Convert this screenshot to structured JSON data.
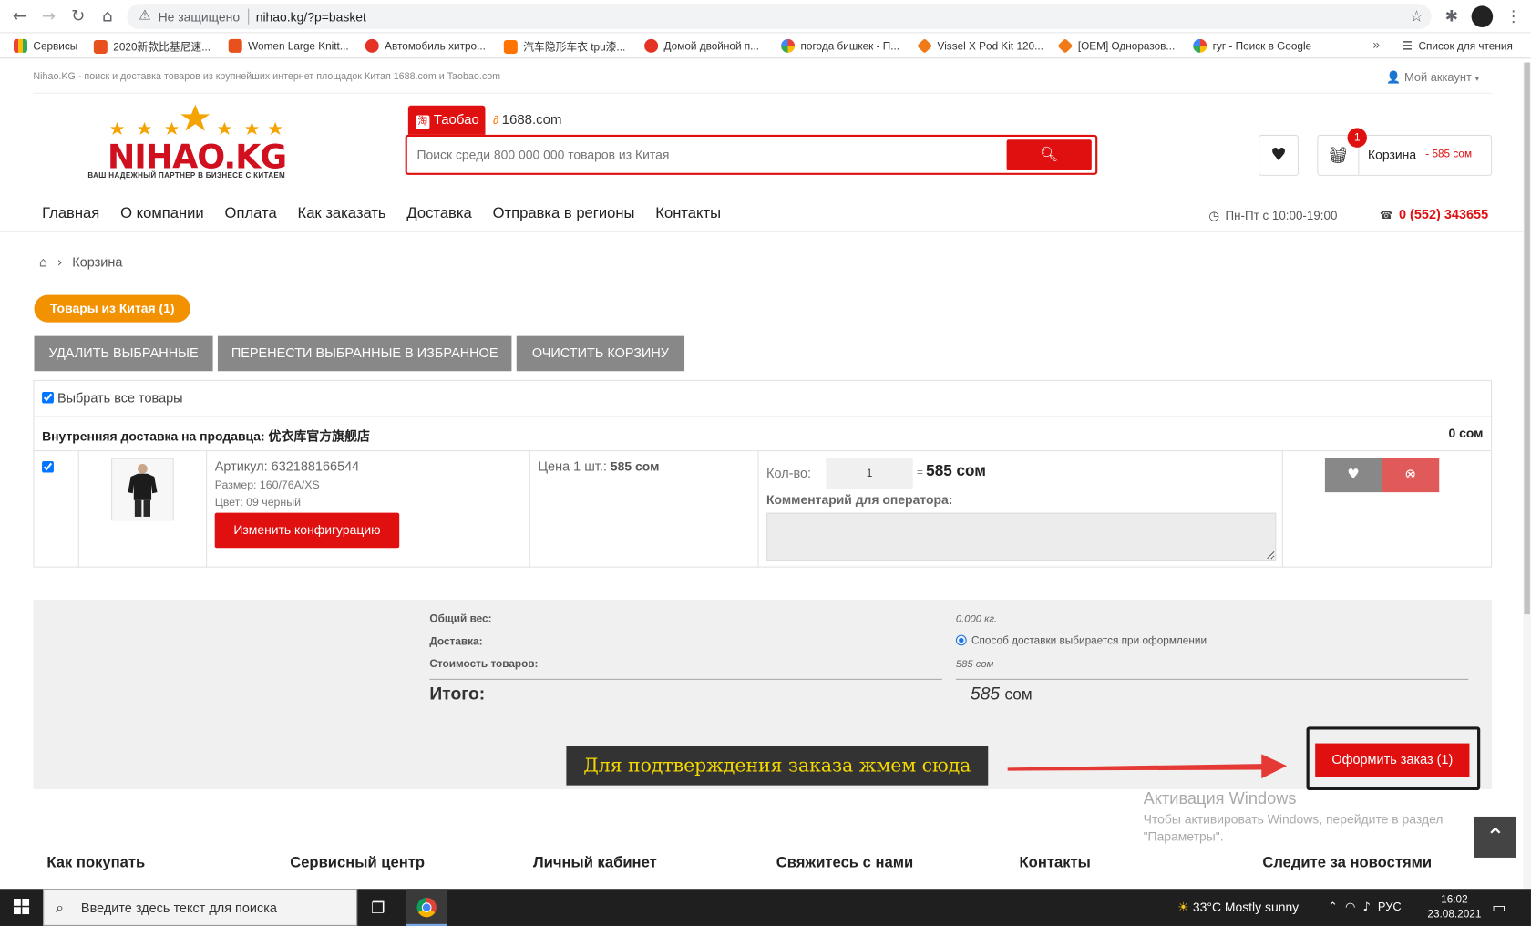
{
  "browser": {
    "insecure_label": "Не защищено",
    "url": "nihao.kg/?p=basket",
    "bookmarks": [
      "Сервисы",
      "2020新款比基尼速...",
      "Women Large Knitt...",
      "Автомобиль хитро...",
      "汽车隐形车衣 tpu漆...",
      "Домой двойной п...",
      "погода бишкек - П...",
      "Vissel X Pod Kit 120...",
      "[OEM] Одноразов...",
      "гуг - Поиск в Google"
    ],
    "reading_list": "Список для чтения",
    "more": "»"
  },
  "site": {
    "tagline": "Nihao.KG - поиск и доставка товаров из крупнейших интернет площадок Китая 1688.com и Taobao.com",
    "account": "Мой аккаунт",
    "logo_name": "NIHAO.KG",
    "logo_slogan": "ВАШ НАДЕЖНЫЙ ПАРТНЕР В БИЗНЕСЕ С КИТАЕМ",
    "tab_taobao": "Таобао",
    "tab_1688": "1688.com",
    "search_placeholder": "Поиск среди 800 000 000 товаров из Китая",
    "cart_count": "1",
    "cart_label": "Корзина",
    "cart_sum": "- 585 сом",
    "menu": [
      "Главная",
      "О компании",
      "Оплата",
      "Как заказать",
      "Доставка",
      "Отправка в регионы",
      "Контакты"
    ],
    "hours": "Пн-Пт с 10:00-19:00",
    "phone": "0 (552) 343655"
  },
  "basket": {
    "breadcrumb": "Корзина",
    "china_tab": "Товары из Китая (1)",
    "btn_delete": "Удалить выбранные",
    "btn_move": "Перенести выбранные в избранное",
    "btn_clear": "Очистить корзину",
    "select_all": "Выбрать все товары",
    "seller": "Внутренняя доставка на продавца: 优衣库官方旗舰店",
    "seller_sum": "0 сом",
    "item": {
      "article": "Артикул: 632188166544",
      "size": "Размер: 160/76A/XS",
      "color": "Цвет: 09 черный",
      "config_btn": "Изменить конфигурацию",
      "price_label": "Цена 1 шт.:",
      "price": "585 сом",
      "qty_label": "Кол-во:",
      "qty": "1",
      "eq": "=",
      "total": "585 сом",
      "comment_label": "Комментарий для оператора:"
    }
  },
  "summary": {
    "weight_label": "Общий вес:",
    "weight": "0.000 кг.",
    "delivery_label": "Доставка:",
    "delivery": "Способ доставки выбирается при оформлении",
    "goods_label": "Стоимость товаров:",
    "goods": "585 сом",
    "total_label": "Итого:",
    "total_num": "585",
    "total_cur": "сом",
    "hint": "Для подтверждения заказа жмем сюда",
    "order_btn": "Оформить заказ (1)"
  },
  "windows": {
    "activation_title": "Активация Windows",
    "activation_text1": "Чтобы активировать Windows, перейдите в раздел",
    "activation_text2": "\"Параметры\".",
    "taskbar_search": "Введите здесь текст для поиска",
    "weather": "33°C  Mostly sunny",
    "lang": "РУС",
    "time": "16:02",
    "date": "23.08.2021"
  },
  "footer": [
    "Как покупать",
    "Сервисный центр",
    "Личный кабинет",
    "Свяжитесь с нами",
    "Контакты",
    "Следите за новостями"
  ],
  "colors": {
    "brand_red": "#e01010",
    "orange": "#f39200",
    "grey_button": "#888888"
  }
}
